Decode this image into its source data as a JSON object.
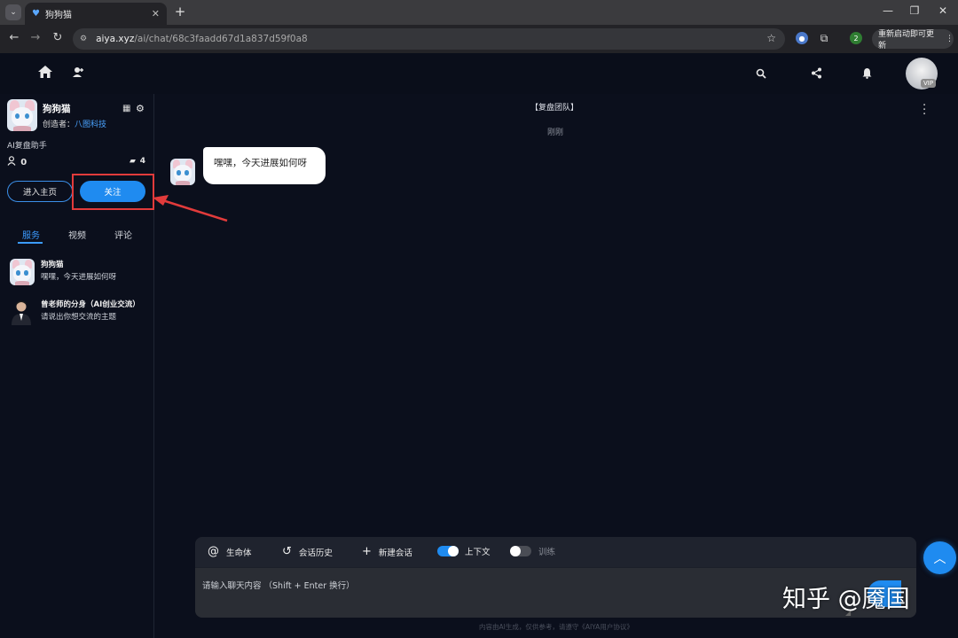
{
  "browser": {
    "tab_title": "狗狗猫",
    "url_host": "aiya.xyz",
    "url_path": "/ai/chat/68c3faadd67d1a837d59f0a8",
    "update_label": "重新启动即可更新",
    "extension_badge": "2"
  },
  "header": {
    "vip_label": "VIP"
  },
  "bot": {
    "name": "狗狗猫",
    "creator_label": "创造者：",
    "creator_name": "八图科技",
    "description": "AI复盘助手",
    "followers": "0",
    "messages": "4",
    "home_button": "进入主页",
    "follow_button": "关注"
  },
  "sidebar_tabs": [
    "服务",
    "视频",
    "评论"
  ],
  "conversations": [
    {
      "title": "狗狗猫",
      "preview": "嘿嘿，今天进展如何呀"
    },
    {
      "title": "曾老师的分身（AI创业交流）",
      "preview": "请说出你想交流的主题"
    }
  ],
  "chat": {
    "title": "【复盘团队】",
    "time": "刚刚",
    "message": "嘿嘿，今天进展如何呀"
  },
  "composer": {
    "tool_lifeform": "生命体",
    "tool_history": "会话历史",
    "tool_new": "新建会话",
    "context_label": "上下文",
    "context_on": true,
    "train_label": "训练",
    "train_on": false,
    "placeholder": "请输入聊天内容 （Shift + Enter 换行）",
    "footer_note": "内容由AI生成，仅供参考，请遵守《AIYA用户协议》"
  },
  "watermark": "知乎 @魇国",
  "colors": {
    "accent": "#1f8bf0",
    "annotation": "#e23b3b",
    "background": "#0b0f1c"
  }
}
